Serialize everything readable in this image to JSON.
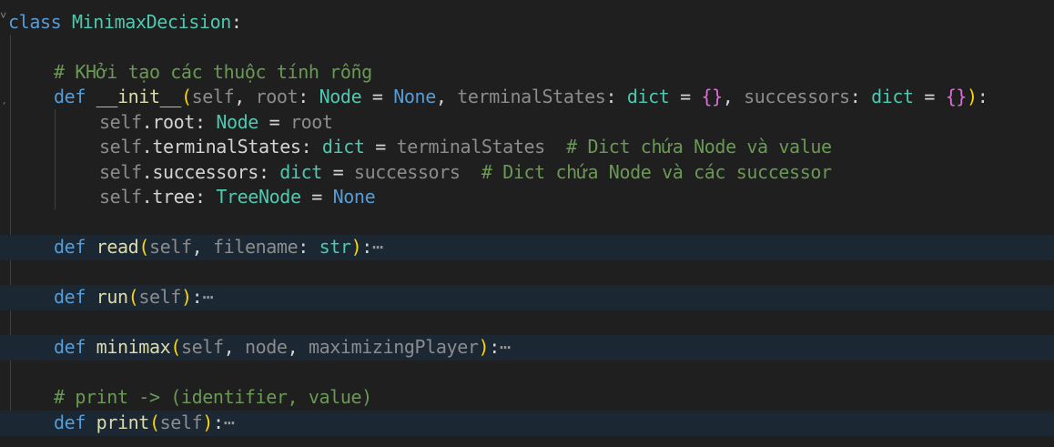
{
  "editor": {
    "language": "python",
    "theme": "dark",
    "colors": {
      "background": "#1f1f1f",
      "folded_line_background": "#1b2733",
      "keyword": "#569cd6",
      "class_type": "#4ec9b0",
      "function": "#dcdcaa",
      "parameter": "#9cdcfe",
      "comment": "#6a9955",
      "bracket_level_1": "#ffd700",
      "bracket_level_2": "#da70d6"
    },
    "lines": {
      "l1": {
        "kw": "class",
        "name": "MinimaxDecision",
        "colon": ":"
      },
      "l3": {
        "comment": "# KHởi tạo các thuộc tính rỗng"
      },
      "l4": {
        "kw": "def",
        "name": "__init__",
        "open": "(",
        "self": "self",
        "c1": ", ",
        "p1": "root",
        "p1c": ": ",
        "t1": "Node",
        "eq1": " = ",
        "v1": "None",
        "c2": ", ",
        "p2": "terminalStates",
        "p2c": ": ",
        "t2": "dict",
        "eq2": " = ",
        "v2": "{}",
        "c3": ", ",
        "p3": "successors",
        "p3c": ": ",
        "t3": "dict",
        "eq3": " = ",
        "v3": "{}",
        "close": ")",
        "colon": ":"
      },
      "l5": {
        "self": "self",
        "dot": ".",
        "attr": "root",
        "colon": ": ",
        "type": "Node",
        "eq": " = ",
        "val": "root"
      },
      "l6": {
        "self": "self",
        "dot": ".",
        "attr": "terminalStates",
        "colon": ": ",
        "type": "dict",
        "eq": " = ",
        "val": "terminalStates",
        "comment": "  # Dict chứa Node và value"
      },
      "l7": {
        "self": "self",
        "dot": ".",
        "attr": "successors",
        "colon": ": ",
        "type": "dict",
        "eq": " = ",
        "val": "successors",
        "comment": "  # Dict chứa Node và các successor"
      },
      "l8": {
        "self": "self",
        "dot": ".",
        "attr": "tree",
        "colon": ": ",
        "type": "TreeNode",
        "eq": " = ",
        "val": "None"
      },
      "l10": {
        "kw": "def",
        "name": "read",
        "open": "(",
        "self": "self",
        "c1": ", ",
        "p1": "filename",
        "p1c": ": ",
        "t1": "str",
        "close": ")",
        "colon": ":",
        "ellipsis": "⋯"
      },
      "l12": {
        "kw": "def",
        "name": "run",
        "open": "(",
        "self": "self",
        "close": ")",
        "colon": ":",
        "ellipsis": "⋯"
      },
      "l14": {
        "kw": "def",
        "name": "minimax",
        "open": "(",
        "self": "self",
        "c1": ", ",
        "p1": "node",
        "c2": ", ",
        "p2": "maximizingPlayer",
        "close": ")",
        "colon": ":",
        "ellipsis": "⋯"
      },
      "l16": {
        "comment": "# print -> (identifier, value)"
      },
      "l17": {
        "kw": "def",
        "name": "print",
        "open": "(",
        "self": "self",
        "close": ")",
        "colon": ":",
        "ellipsis": "⋯"
      }
    }
  }
}
